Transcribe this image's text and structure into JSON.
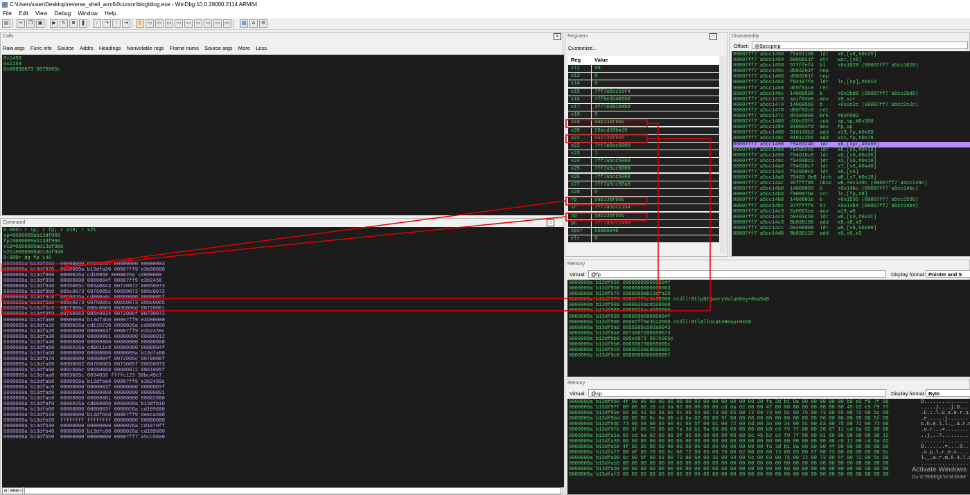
{
  "window": {
    "title": "C:\\Users\\user\\Desktop\\reverse_shell_arm64\\cursor\\blog\\blog.exe - WinDbg:10.0.28000.2114 ARM64"
  },
  "menu": [
    "File",
    "Edit",
    "View",
    "Debug",
    "Window",
    "Help"
  ],
  "calls": {
    "title": "Calls",
    "buttons": [
      "Raw args",
      "Func info",
      "Source",
      "Addrs",
      "Headings",
      "Nonvolatile regs",
      "Frame nums",
      "Source args",
      "More",
      "Less"
    ],
    "lines": [
      "0x1490",
      "0x1154",
      "0x00650073`0075005c"
    ]
  },
  "registers": {
    "title": "Registers",
    "customize": "Customize...",
    "col_reg": "Reg",
    "col_value": "Value",
    "rows": [
      {
        "reg": "x12",
        "value": "40"
      },
      {
        "reg": "x13",
        "value": "0"
      },
      {
        "reg": "x14",
        "value": "0"
      },
      {
        "reg": "x15",
        "value": "7ff7a5cc16f4"
      },
      {
        "reg": "x16",
        "value": "7ff9e3b48550"
      },
      {
        "reg": "x17",
        "value": "3f776081b8b9"
      },
      {
        "reg": "x18",
        "value": "0"
      },
      {
        "reg": "x19",
        "value": "9ab13df9b0"
      },
      {
        "reg": "x20",
        "value": "26acd10ba10"
      },
      {
        "reg": "x21",
        "value": "9ab13df9d0"
      },
      {
        "reg": "x22",
        "value": "7ff7a5cc5000"
      },
      {
        "reg": "x23",
        "value": "1"
      },
      {
        "reg": "x24",
        "value": "7ff7a5cc5000"
      },
      {
        "reg": "x25",
        "value": "7ff7a5cc5000"
      },
      {
        "reg": "x26",
        "value": "7ff7a5cc5000"
      },
      {
        "reg": "x27",
        "value": "7ff7a5cc50a0"
      },
      {
        "reg": "x28",
        "value": "0"
      },
      {
        "reg": "fp",
        "value": "9ab13df960"
      },
      {
        "reg": "lr",
        "value": "7ff7a5cc1154"
      },
      {
        "reg": "sp",
        "value": "9ab13df960"
      },
      {
        "reg": "pc",
        "value": "7ff7a5cc1490"
      },
      {
        "reg": "cpsr",
        "value": "60000040"
      },
      {
        "reg": "elr",
        "value": "0"
      }
    ]
  },
  "disassembly": {
    "title": "Disassembly",
    "offset_label": "Offset:",
    "offset_value": "@$scopeip",
    "lines": [
      {
        "addr": "00007ff7`a5cc1450",
        "bytes": "f9401108",
        "op": "ldr",
        "args": "x8,[x8,#0x20]"
      },
      {
        "addr": "00007ff7`a5cc1454",
        "bytes": "b900011f",
        "op": "str",
        "args": "wzr,[x8]"
      },
      {
        "addr": "00007ff7`a5cc1458",
        "bytes": "97fffef4",
        "op": "bl",
        "args": "+0x1028 (00007ff7`a5cc1028)"
      },
      {
        "addr": "00007ff7`a5cc145c",
        "bytes": "d503201f",
        "op": "nop",
        "args": ""
      },
      {
        "addr": "00007ff7`a5cc1460",
        "bytes": "d503201f",
        "op": "nop",
        "args": ""
      },
      {
        "addr": "00007ff7`a5cc1464",
        "bytes": "f84107fe",
        "op": "ldr",
        "args": "lr,[sp],#0x10"
      },
      {
        "addr": "00007ff7`a5cc1468",
        "bytes": "d65f03c0",
        "op": "ret",
        "args": ""
      },
      {
        "addr": "00007ff7`a5cc146c",
        "bytes": "14000500",
        "op": "b",
        "args": "+0x2bd8 (00007ff7`a5cc2bd8)"
      },
      {
        "addr": "00007ff7`a5cc1470",
        "bytes": "aa1f03e0",
        "op": "mov",
        "args": "x0,xzr"
      },
      {
        "addr": "00007ff7`a5cc1474",
        "bytes": "14000560",
        "op": "b",
        "args": "+0x2c2c (00007ff7`a5cc2c2c)"
      },
      {
        "addr": "00007ff7`a5cc1478",
        "bytes": "d65f03c0",
        "op": "ret",
        "args": ""
      },
      {
        "addr": "00007ff7`a5cc147c",
        "bytes": "d43e0000",
        "op": "brk",
        "args": "#0xF000"
      },
      {
        "addr": "00007ff7`a5cc1480",
        "bytes": "d10c03ff",
        "op": "sub",
        "args": "sp,sp,#0x300"
      },
      {
        "addr": "00007ff7`a5cc1484",
        "bytes": "910003fd",
        "op": "mov",
        "args": "fp,sp"
      },
      {
        "addr": "00007ff7`a5cc1488",
        "bytes": "910143b3",
        "op": "add",
        "args": "x19,fp,#0x50"
      },
      {
        "addr": "00007ff7`a5cc148c",
        "bytes": "9101c3b5",
        "op": "add",
        "args": "x21,fp,#0x70"
      },
      {
        "addr": "00007ff7`a5cc1490",
        "bytes": "f9403246",
        "op": "ldr",
        "args": "x6,[xpr,#0x60]"
      },
      {
        "addr": "00007ff7`a5cc1494",
        "bytes": "f9400cc6",
        "op": "ldr",
        "args": "x6,[x6,#0x18]"
      },
      {
        "addr": "00007ff7`a5cc1498",
        "bytes": "f94018c6",
        "op": "ldr",
        "args": "x6,[x6,#0x30]"
      },
      {
        "addr": "00007ff7`a5cc149c",
        "bytes": "f94008c3",
        "op": "ldr",
        "args": "x3,[x6,#0x10]"
      },
      {
        "addr": "00007ff7`a5cc14a0",
        "bytes": "f94020c7",
        "op": "ldr",
        "args": "x7,[x6,#0x40]"
      },
      {
        "addr": "00007ff7`a5cc14a4",
        "bytes": "f94000c6",
        "op": "ldr",
        "args": "x6,[x6]"
      },
      {
        "addr": "00007ff7`a5cc14a8",
        "bytes": "79403 0e8",
        "op": "ldrh",
        "args": "w8,[x7,#0x18]"
      },
      {
        "addr": "00007ff7`a5cc14ac",
        "bytes": "35ffff88",
        "op": "cbnz",
        "args": "w8,+0x149c (00007ff7`a5cc149c)"
      },
      {
        "addr": "00007ff7`a5cc14b0",
        "bytes": "14000003",
        "op": "b",
        "args": "+0x14bc (00007ff7`a5cc14bc)"
      },
      {
        "addr": "00007ff7`a5cc14b4",
        "bytes": "f90007be",
        "op": "str",
        "args": "lr,[fp,#8]"
      },
      {
        "addr": "00007ff7`a5cc14b8",
        "bytes": "1400001e",
        "op": "b",
        "args": "+0x1530 (00007ff7`a5cc1530)"
      },
      {
        "addr": "00007ff7`a5cc14bc",
        "bytes": "97fffffe",
        "op": "bl",
        "args": "+0x14b4 (00007ff7`a5cc14b4)"
      },
      {
        "addr": "00007ff7`a5cc14c0",
        "bytes": "2a0003ea",
        "op": "mov",
        "args": "w10,w0"
      },
      {
        "addr": "00007ff7`a5cc14c4",
        "bytes": "b9403c68",
        "op": "ldr",
        "args": "w8,[x3,#0x3C]"
      },
      {
        "addr": "00007ff7`a5cc14c8",
        "bytes": "8b030108",
        "op": "add",
        "args": "x8,x8,x3"
      },
      {
        "addr": "00007ff7`a5cc14cc",
        "bytes": "b9408909",
        "op": "ldr",
        "args": "w9,[x8,#0x88]"
      },
      {
        "addr": "00007ff7`a5cc14d0",
        "bytes": "8b030129",
        "op": "add",
        "args": "x9,x9,x3"
      }
    ]
  },
  "command": {
    "title": "Command",
    "header_lines": [
      "0:000> r sp; r fp; r x19; r x21",
      "sp=0000009ab13df960",
      "fp=0000009ab13df960",
      "x19=0000009ab13df9b0",
      "x21=0000009ab13df9d0",
      "0:000> dq fp L40"
    ],
    "dump_lines": [
      "0000009a`b13df960  00000000`0000004f 00000000`00000003",
      "0000009a`b13df970  0000009a`b13dfa20 00007ff9`e3b90000",
      "0000009a`b13df980  0000026a`cd10960 0000026a`cd000000",
      "0000009a`b13df990  00000000`0000004f 00007ff9`e3b2450",
      "0000009a`b13df9a0  0055005c`003a0043 00730072`00650073",
      "0000009a`b13df9b0  005c0073`0075005c 00650073`005c0072",
      "0000009a`b13df9c0  0000026a`cd000a0c 00000000`0000005f",
      "0000009a`b13df9d0  005c0073`0075005c 00650073`005c0065",
      "0000009a`b13df9e0  005f006c`006c0065 0036006d`00720061",
      "0000009a`b13df9f0  00750063`005c0034 0072006f`00730072",
      "0000009a`b13dfa00  0000009a`b13dfab0 00007ff9`e3b90000",
      "0000009a`b13dfa10  0000026a`cd116720 0000026a`cd000000",
      "0000009a`b13dfa20  00000000`0000003f 00007ff9`e3b2459c",
      "0000009a`b13dfa30  00000000`00000001 00000000`00000012",
      "0000009a`b13dfa40  00000000`00000000 00000000`00000000",
      "0000009a`b13dfa50  0000026a`cd0011c0 00000000`0000004f",
      "0000009a`b13dfa60  00000000`00000000 0000009a`b13dfa80",
      "0000009a`b13dfa70  00000000`0000004f 0072005c`0070006f",
      "0000009a`b13dfa80  00000002`00760065 0073005f`00650073",
      "0000009a`b13dfa90  006c006c`00650068 006d0072`0061005f",
      "0000009a`b13dfaa0  0063005c`0034036 ffffc123`50bc49e7",
      "0000009a`b13dfab0  0000009a`b13dfbe0 00007ff9`e3b2459c",
      "0000009a`b13dfac0  00000000`0000003f 00000000`0000003f",
      "0000009a`b13dfad0  00000000`00000000 00000000`00000001",
      "0000009a`b13dfae0  00000000`00000001 00000000`00002000",
      "0000009a`b13dfaf0  0000026a`cd000000 0000009a`b13dfb10",
      "0000009a`b13dfb00  00000000`0000003f 0000026a`cd109600",
      "0000009a`b13dfb10  00000000`b13dfb60 00007ff9`deeca508",
      "0000009a`b13dfb20  ffffffff`ffffffff 00000000`00000000",
      "0000009a`b13dfb30  00000000`00000000 0000026a`cd1070ff",
      "0000009a`b13dfb40  00000000`b13dfc08 0000026a`cd109600",
      "0000009a`b13dfb50  00000000`00000000 00007ff7`a5cc50a0"
    ],
    "prompt": "0:000>"
  },
  "memory1": {
    "title": "Memory",
    "virtual_label": "Virtual:",
    "virtual_value": "@fp",
    "display_label": "Display format:",
    "display_value": "Pointer and S",
    "lines": [
      "0000009a`b13df960 000000000000004f",
      "0000009a`b13df968 0000000000000003",
      "0000009a`b13df970 0000009ab13dfa20",
      "0000009a`b13df978 00007ff9e3b90000 ntdll!RtlpNtQueryValueKey+0xa5a0",
      "0000009a`b13df980 0000026acd109600",
      "0000009a`b13df988 0000026acd000000",
      "0000009a`b13df990 000000000000004f",
      "0000009a`b13df998 00007ff9e3b24500 ntdll!RtlAllocateHeap+0xb0",
      "0000009a`b13df9a0 0055005c003a0043",
      "0000009a`b13df9a8 0073007200650073",
      "0000009a`b13df9b0 005c0073`0075005c",
      "0000009a`b13df9b8 006500730065005c",
      "0000009a`b13df9c0 0000026acd000a0c",
      "0000009a`b13df9c8 000000000000005f"
    ]
  },
  "memory2": {
    "title": "Memory",
    "virtual_label": "Virtual:",
    "virtual_value": "@sp",
    "display_label": "Display format:",
    "display_value": "Byte",
    "lines": [
      "0000009a`b13df960 4f 00 00 00 00 00 00 00 03 00 00 00 00 00 00 20 fa 3d b1 9a 00 00 00 00 00 b9 e3 f9 7f 00",
      "0000009a`b13df97f 00 00 96 10 cd 6a 02 00 00 00 00 cd 6a 02 00 00 4f 00 00 00 00 00 00 00 00 45 b2 e3 f9 7f",
      "0000009a`b13df99e 00 00 43 00 3a 00 5c 00 55 00 73 00 65 00 72 00 73 00 5c 00 75 00 73 00 65 00 72 00 5c 00",
      "0000009a`b13df9bd 00 65 00 0c 0a 00 cd 6a 02 00 00 5f 00 00 00 00 00 00 00 00 00 00 00 00 00 00 65 00 5f 00",
      "0000009a`b13df9dc 73 00 68 00 65 00 6c 00 5f 00 61 00 72 00 6d 00 36 00 34 00 5c 00 63 00 75 00 72 00 73 00",
      "0000009a`b13df9fb 00 6f 00 72 00 b0 fa 3d b1 9a 00 00 00 00 00 00 b9 e3 f9 7f 00 00 20 67 11 cd 6a 02 00 00",
      "0000009a`b13dfa1a 00 cd 6a 02 00 00 3f 00 00 00 00 00 00 00 9c 45 b2 e3 f9 7f 00 00 01 00 00 00 00 00 00 12",
      "0000009a`b13dfa39 00 00 00 00 00 00 00 00 00 00 00 00 00 00 00 00 00 00 00 00 00 00 00 00 c0 11 00 cd 6a 02",
      "0000009a`b13dfa58 4f 00 00 00 00 00 00 00 00 00 00 00 00 00 00 80 fa 3d b1 9a 00 00 00 4f 00 00 00 00 00 00",
      "0000009a`b13dfa77 00 6f 00 70 00 5c 00 72 00 65 00 76 00 02 00 00 00 73 00 65 00 5f 00 73 00 68 00 65 00 6c",
      "0000009a`b13dfa96 6c 00 5f 00 61 00 72 00 6d 00 36 00 34 00 5c 00 63 00 75 00 72 00 73 00 6f 00 72 00 5c 00",
      "0000009a`b13dfab5 00 00 00 00 00 00 00 00 00 00 00 00 00 00 00 00 00 00 00 00 00 00 00 00 00 00 00 00 00 00",
      "0000009a`b13dfad4 00 00 00 00 00 00 00 00 00 00 00 00 00 00 00 00 00 00 00 00 00 00 00 00 00 00 00 00 00 00",
      "0000009a`b13dfaf3 00 00 00 00 00 00 00 00 00 00 00 00 00 00 00 00 00 00 00 00 00 00 00 00 00 00 00 00 00 00"
    ],
    "ascii": [
      "O...............",
      ".....j....j.O...",
      ".C.:.\\.U.s.e.r.s.",
      ".e......j..._...",
      "s.h.e.l.l._.a.r.m",
      ".o.r...=........",
      "..j...?.........",
      "................",
      "O.......=....O..",
      ".o.p.\\.r.e.v....",
      "l._.a.r.m.6.4.\\.c",
      "................",
      "................",
      "................"
    ]
  },
  "watermark": {
    "line1": "Activate Windows",
    "line2": "Go to Settings to activate"
  }
}
